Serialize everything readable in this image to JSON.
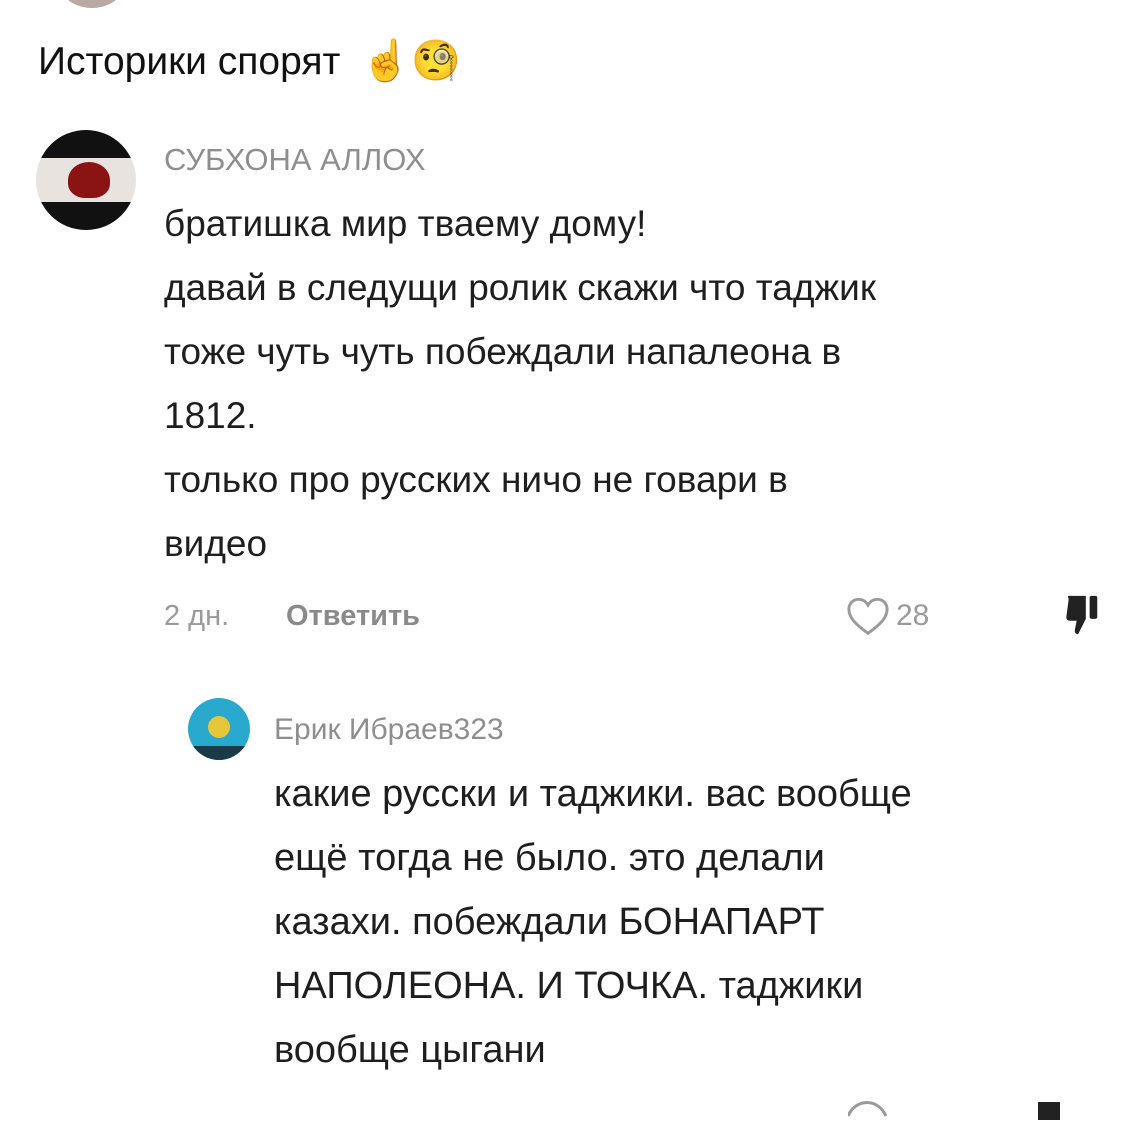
{
  "post": {
    "caption": "Историки спорят",
    "caption_emojis": "☝️🧐"
  },
  "comments": [
    {
      "username": "СУБХОНА АЛЛОХ",
      "lines": [
        "братишка мир тваему дому!",
        "давай в следущи ролик скажи что таджик",
        "тоже чуть чуть побеждали напалеона в",
        "1812.",
        "только про русских ничо не говари в",
        "видео"
      ],
      "time": "2 дн.",
      "reply_label": "Ответить",
      "likes": "28"
    },
    {
      "username": "Ерик Ибраев323",
      "lines": [
        "какие русски и таджики. вас вообще",
        "ещё тогда не было. это делали",
        "казахи. побеждали БОНАПАРТ",
        "НАПОЛЕОНА. И ТОЧКА. таджики",
        "вообще цыгани"
      ]
    }
  ],
  "icons": {
    "like": "heart-outline-icon",
    "dislike": "thumbs-down-icon"
  }
}
